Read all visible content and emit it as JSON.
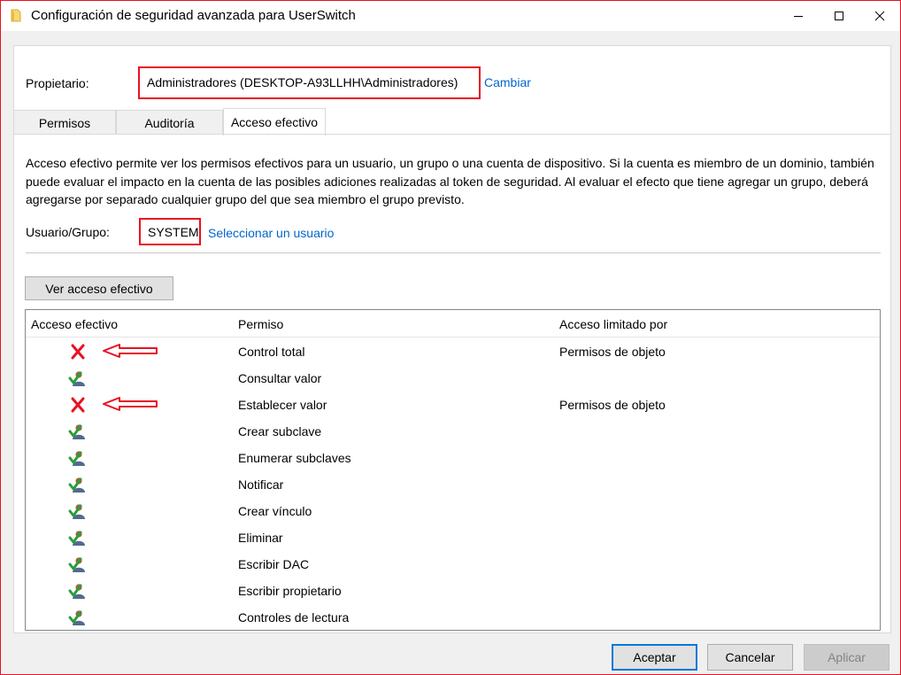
{
  "window": {
    "title": "Configuración de seguridad avanzada para UserSwitch"
  },
  "owner": {
    "label": "Propietario:",
    "value": "Administradores (DESKTOP-A93LLHH\\Administradores)",
    "change_link": "Cambiar"
  },
  "tabs": [
    {
      "label": "Permisos",
      "active": false
    },
    {
      "label": "Auditoría",
      "active": false
    },
    {
      "label": "Acceso efectivo",
      "active": true
    }
  ],
  "description": "Acceso efectivo permite ver los permisos efectivos para un usuario, un grupo o una cuenta de dispositivo. Si la cuenta es miembro de un dominio, también puede evaluar el impacto en la cuenta de las posibles adiciones realizadas al token de seguridad. Al evaluar el efecto que tiene agregar un grupo, deberá agregarse por separado cualquier grupo del que sea miembro el grupo previsto.",
  "user_group": {
    "label": "Usuario/Grupo:",
    "value": "SYSTEM",
    "select_link": "Seleccionar un usuario"
  },
  "view_button": "Ver acceso efectivo",
  "table": {
    "columns": [
      "Acceso efectivo",
      "Permiso",
      "Acceso limitado por"
    ],
    "rows": [
      {
        "access": "denied",
        "permission": "Control total",
        "limited_by": "Permisos de objeto",
        "annotated": true
      },
      {
        "access": "allowed",
        "permission": "Consultar valor",
        "limited_by": "",
        "annotated": false
      },
      {
        "access": "denied",
        "permission": "Establecer valor",
        "limited_by": "Permisos de objeto",
        "annotated": true
      },
      {
        "access": "allowed",
        "permission": "Crear subclave",
        "limited_by": "",
        "annotated": false
      },
      {
        "access": "allowed",
        "permission": "Enumerar subclaves",
        "limited_by": "",
        "annotated": false
      },
      {
        "access": "allowed",
        "permission": "Notificar",
        "limited_by": "",
        "annotated": false
      },
      {
        "access": "allowed",
        "permission": "Crear vínculo",
        "limited_by": "",
        "annotated": false
      },
      {
        "access": "allowed",
        "permission": "Eliminar",
        "limited_by": "",
        "annotated": false
      },
      {
        "access": "allowed",
        "permission": "Escribir DAC",
        "limited_by": "",
        "annotated": false
      },
      {
        "access": "allowed",
        "permission": "Escribir propietario",
        "limited_by": "",
        "annotated": false
      },
      {
        "access": "allowed",
        "permission": "Controles de lectura",
        "limited_by": "",
        "annotated": false
      }
    ]
  },
  "footer": {
    "accept": "Aceptar",
    "cancel": "Cancelar",
    "apply": "Aplicar"
  },
  "colors": {
    "highlight_red": "#e81123",
    "link_blue": "#0066cc",
    "accent": "#0078d7"
  },
  "icons": {
    "title": "folder-icon",
    "denied": "red-x-icon",
    "allowed": "user-check-icon",
    "annotation": "red-arrow-icon"
  }
}
